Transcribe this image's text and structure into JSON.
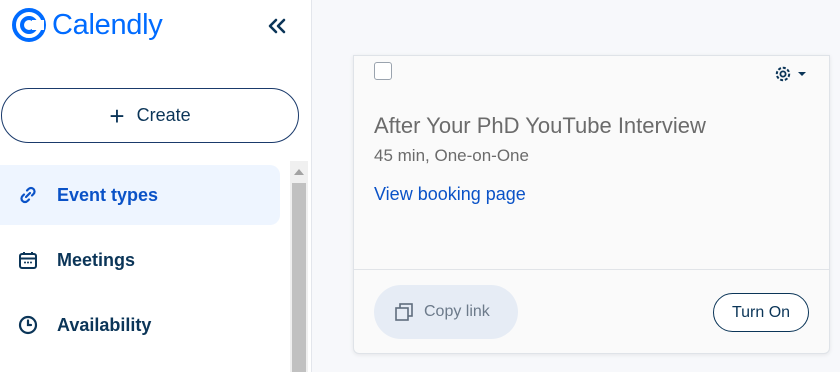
{
  "brand": {
    "name": "Calendly",
    "color": "#006bff"
  },
  "sidebar": {
    "collapse_icon": "double-chevron-left-icon",
    "create_label": "Create",
    "items": [
      {
        "label": "Event types",
        "icon": "link-icon",
        "active": true
      },
      {
        "label": "Meetings",
        "icon": "calendar-icon",
        "active": false
      },
      {
        "label": "Availability",
        "icon": "clock-icon",
        "active": false
      }
    ]
  },
  "event_card": {
    "title": "After Your PhD YouTube Interview",
    "subtitle": "45 min, One-on-One",
    "view_link": "View booking page",
    "copy_label": "Copy link",
    "turn_on_label": "Turn On",
    "settings_icon": "gear-icon"
  },
  "colors": {
    "accent": "#006bff",
    "navy": "#0b3558",
    "active_bg": "#eef5ff"
  }
}
